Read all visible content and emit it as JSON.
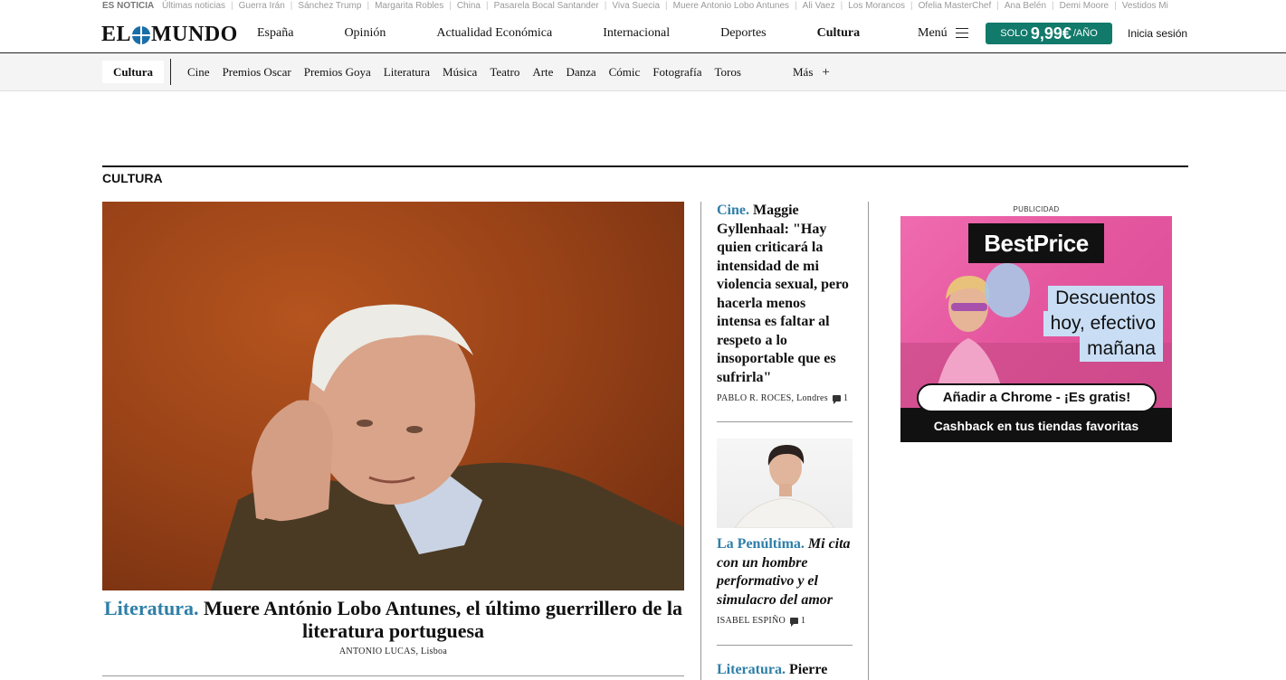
{
  "ticker": {
    "lead": "ES NOTICIA",
    "items": [
      "Últimas noticias",
      "Guerra Irán",
      "Sánchez Trump",
      "Margarita Robles",
      "China",
      "Pasarela Bocal Santander",
      "Viva Suecia",
      "Muere Antonio Lobo Antunes",
      "Ali Vaez",
      "Los Morancos",
      "Ofelia MasterChef",
      "Ana Belén",
      "Demi Moore",
      "Vestidos Mi"
    ]
  },
  "header": {
    "logo": {
      "left": "EL",
      "right": "MUNDO"
    },
    "nav": [
      "España",
      "Opinión",
      "Actualidad Económica",
      "Internacional",
      "Deportes",
      "Cultura"
    ],
    "active_nav": "Cultura",
    "menu_label": "Menú",
    "promo": {
      "pre": "SOLO",
      "price": "9,99€",
      "suffix": "/AÑO"
    },
    "login": "Inicia sesión"
  },
  "subnav": {
    "section": "Cultura",
    "items": [
      "Cine",
      "Premios Oscar",
      "Premios Goya",
      "Literatura",
      "Música",
      "Teatro",
      "Arte",
      "Danza",
      "Cómic",
      "Fotografía",
      "Toros"
    ],
    "more": "Más",
    "more_icon": "+"
  },
  "section_title": "CULTURA",
  "lead": {
    "kicker": "Literatura.",
    "headline": "Muere António Lobo Antunes, el último guerrillero de la literatura portuguesa",
    "byline": "ANTONIO LUCAS, Lisboa"
  },
  "mid": [
    {
      "kicker": "Cine.",
      "headline": "Maggie Gyllenhaal: \"Hay quien criticará la intensidad de mi violencia sexual, pero hacerla menos intensa es faltar al respeto a lo insoportable que es sufrirla\"",
      "byline": "PABLO R. ROCES, Londres",
      "comments": "1"
    },
    {
      "kicker": "La Penúltima.",
      "headline": "Mi cita con un hombre performativo y el simulacro del amor",
      "byline": "ISABEL ESPIÑO",
      "comments": "1"
    },
    {
      "kicker": "Literatura.",
      "headline": "Pierre"
    }
  ],
  "ad": {
    "label": "PUBLICIDAD",
    "brand": "BestPrice",
    "lines": [
      "Descuentos",
      "hoy, efectivo",
      "mañana"
    ],
    "cta": "Añadir a Chrome - ¡Es gratis!",
    "footer": "Cashback en tus tiendas favoritas"
  },
  "colors": {
    "kicker": "#2e7fa8",
    "promo": "#127a6b",
    "ad_pink": "#e4579f"
  }
}
